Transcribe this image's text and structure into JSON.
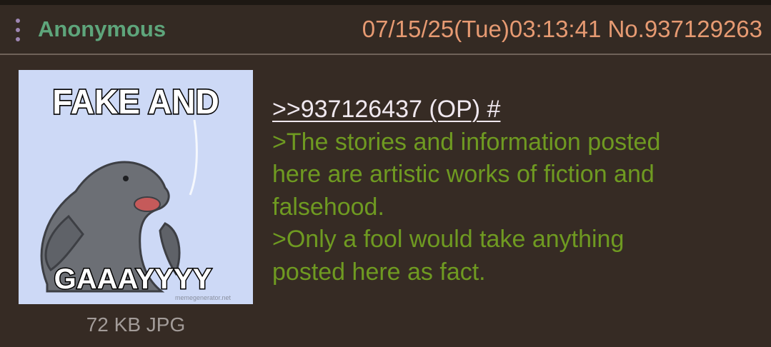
{
  "header": {
    "menu_icon": "vertical-ellipsis-icon",
    "name": "Anonymous",
    "datetime": "07/15/25(Tue)03:13:41",
    "post_number": "No.937129263"
  },
  "image": {
    "caption_top": "FAKE AND",
    "caption_bottom": "GAAAYYYY",
    "watermark": "memegenerator.net",
    "file_info": "72 KB JPG"
  },
  "comment": {
    "quotelink": ">>937126437 (OP) #",
    "lines": [
      ">The stories and information posted",
      "here are artistic works of fiction and",
      "falsehood.",
      ">Only a fool would take anything",
      "posted here as fact."
    ]
  },
  "colors": {
    "background": "#362b24",
    "name": "#5ea57b",
    "meta": "#e69a72",
    "greentext": "#6f9a21",
    "quotelink": "#f0e8ef"
  }
}
